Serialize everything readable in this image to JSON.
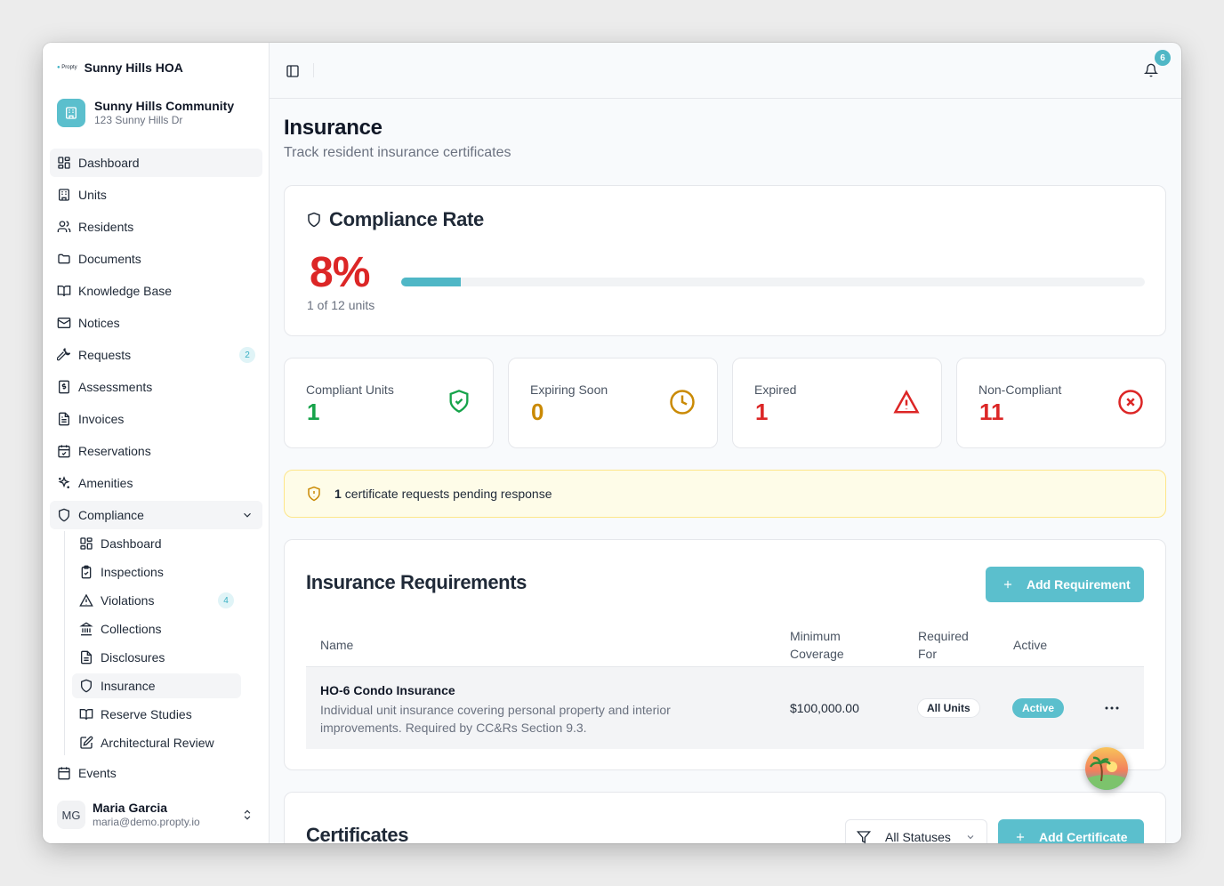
{
  "brand": {
    "logo_text": "Propty",
    "name": "Sunny Hills HOA"
  },
  "community": {
    "name": "Sunny Hills Community",
    "address": "123 Sunny Hills Dr"
  },
  "nav": {
    "dashboard": "Dashboard",
    "units": "Units",
    "residents": "Residents",
    "documents": "Documents",
    "knowledge_base": "Knowledge Base",
    "notices": "Notices",
    "requests": "Requests",
    "requests_badge": "2",
    "assessments": "Assessments",
    "invoices": "Invoices",
    "reservations": "Reservations",
    "amenities": "Amenities",
    "compliance": "Compliance",
    "events": "Events"
  },
  "compliance_sub": {
    "dashboard": "Dashboard",
    "inspections": "Inspections",
    "violations": "Violations",
    "violations_badge": "4",
    "collections": "Collections",
    "disclosures": "Disclosures",
    "insurance": "Insurance",
    "reserve_studies": "Reserve Studies",
    "architectural_review": "Architectural Review"
  },
  "user": {
    "initials": "MG",
    "name": "Maria Garcia",
    "email": "maria@demo.propty.io"
  },
  "topbar": {
    "notification_count": "6"
  },
  "page": {
    "title": "Insurance",
    "subtitle": "Track resident insurance certificates"
  },
  "compliance_rate": {
    "title": "Compliance Rate",
    "percent_label": "8%",
    "percent": 8,
    "units_label": "1 of 12 units"
  },
  "stats": [
    {
      "label": "Compliant Units",
      "value": "1",
      "color": "#16a34a"
    },
    {
      "label": "Expiring Soon",
      "value": "0",
      "color": "#ca8a04"
    },
    {
      "label": "Expired",
      "value": "1",
      "color": "#dc2626"
    },
    {
      "label": "Non-Compliant",
      "value": "11",
      "color": "#dc2626"
    }
  ],
  "alert": {
    "count": "1",
    "text": "certificate requests pending response"
  },
  "requirements": {
    "title": "Insurance Requirements",
    "add_button": "Add Requirement",
    "columns": {
      "name": "Name",
      "coverage": "Minimum Coverage",
      "required_for": "Required For",
      "active": "Active"
    },
    "rows": [
      {
        "name": "HO-6 Condo Insurance",
        "description": "Individual unit insurance covering personal property and interior improvements. Required by CC&Rs Section 9.3.",
        "coverage": "$100,000.00",
        "required_for": "All Units",
        "active": "Active"
      }
    ]
  },
  "certificates": {
    "title": "Certificates",
    "filter_label": "All Statuses",
    "add_button": "Add Certificate"
  },
  "colors": {
    "accent": "#5bbfcd",
    "danger": "#dc2626",
    "success": "#16a34a",
    "warning": "#ca8a04"
  }
}
